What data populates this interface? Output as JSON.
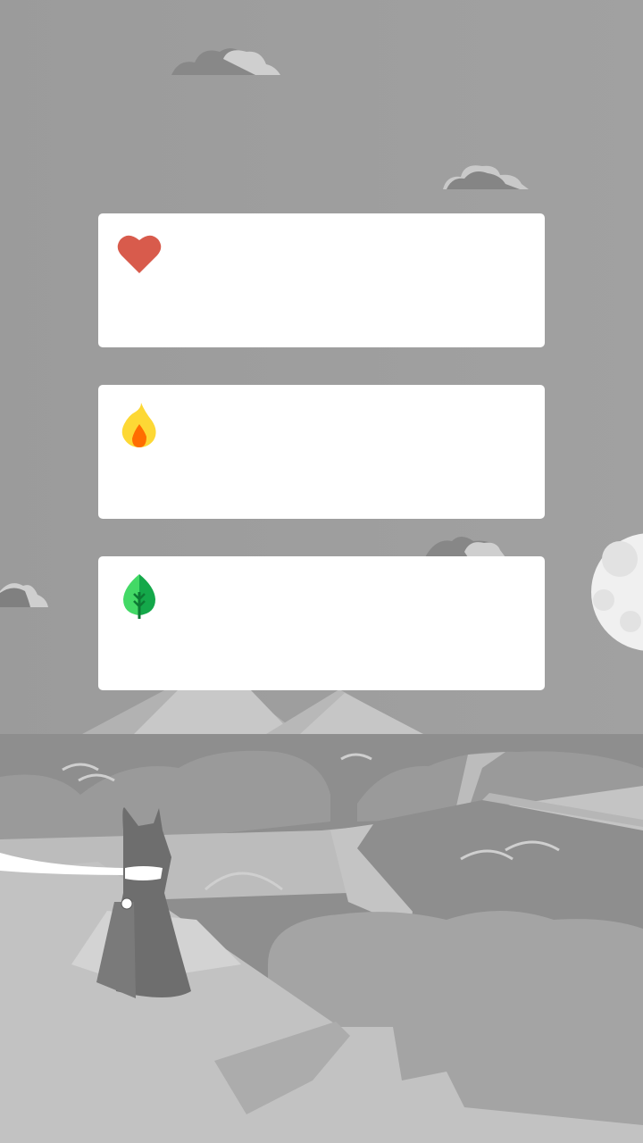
{
  "cards": [
    {
      "id": "heart",
      "icon": "heart-icon",
      "label": ""
    },
    {
      "id": "flame",
      "icon": "flame-icon",
      "label": ""
    },
    {
      "id": "leaf",
      "icon": "leaf-icon",
      "label": ""
    }
  ],
  "colors": {
    "sky": "#9e9e9e",
    "card_background": "#ffffff",
    "heart": "#d85b4c",
    "flame_outer": "#fdd835",
    "flame_inner": "#ff6d00",
    "leaf_light": "#43d966",
    "leaf_dark": "#14a84a",
    "moon": "#f0f0f0"
  }
}
